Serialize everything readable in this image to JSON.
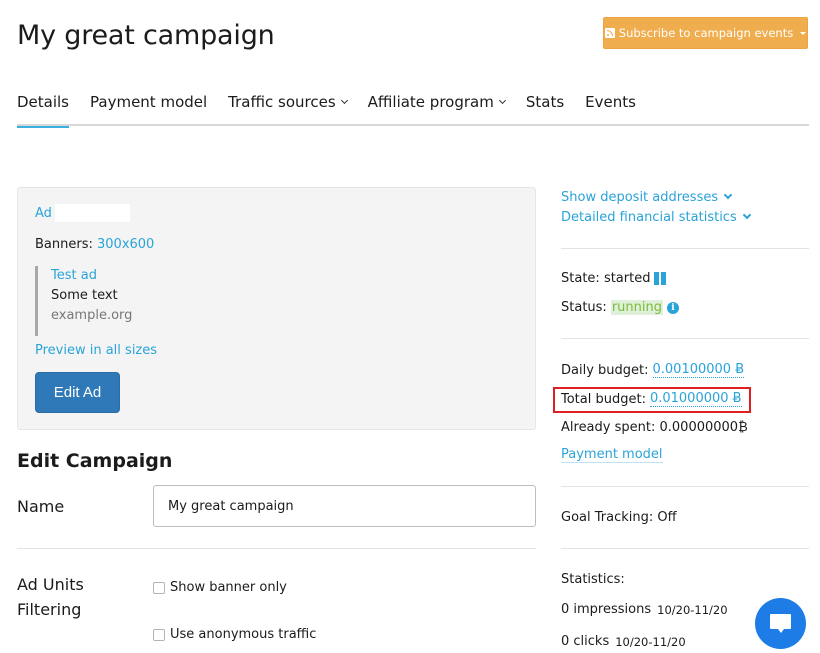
{
  "header": {
    "title": "My great campaign",
    "subscribe_label": "Subscribe to campaign events",
    "subscribe_color": "#f0ad4e"
  },
  "tabs": [
    {
      "label": "Details",
      "active": true,
      "has_dropdown": false
    },
    {
      "label": "Payment model",
      "active": false,
      "has_dropdown": false
    },
    {
      "label": "Traffic sources",
      "active": false,
      "has_dropdown": true
    },
    {
      "label": "Affiliate program",
      "active": false,
      "has_dropdown": true
    },
    {
      "label": "Stats",
      "active": false,
      "has_dropdown": false
    },
    {
      "label": "Events",
      "active": false,
      "has_dropdown": false
    }
  ],
  "ad_card": {
    "ad_label": "Ad",
    "banners_label": "Banners:",
    "banners_value": "300x600",
    "preview": {
      "title": "Test ad",
      "text": "Some text",
      "url": "example.org"
    },
    "preview_all_label": "Preview in all sizes",
    "edit_label": "Edit Ad"
  },
  "edit_campaign": {
    "title": "Edit Campaign",
    "name_label": "Name",
    "name_value": "My great campaign",
    "filtering_label_1": "Ad Units",
    "filtering_label_2": "Filtering",
    "options": [
      {
        "label": "Show banner only",
        "checked": false
      },
      {
        "label": "Use anonymous traffic",
        "checked": false
      }
    ]
  },
  "sidebar": {
    "deposit_link": "Show deposit addresses",
    "financial_link": "Detailed financial statistics",
    "state_label": "State:",
    "state_value": "started",
    "status_label": "Status:",
    "status_value": "running",
    "daily_budget_label": "Daily budget:",
    "daily_budget_value": "0.00100000 Ƀ",
    "total_budget_label": "Total budget:",
    "total_budget_value": "0.01000000 Ƀ",
    "spent_label": "Already spent:",
    "spent_value": "0.00000000₿",
    "payment_model_link": "Payment model",
    "goal_tracking": "Goal Tracking: Off",
    "statistics_label": "Statistics:",
    "impressions": "0 impressions",
    "impressions_range": "10/20-11/20",
    "clicks": "0 clicks",
    "clicks_range": "10/20-11/20"
  },
  "colors": {
    "accent": "#2aa3d9",
    "primary_button": "#2f79b9",
    "highlight": "#e02020",
    "running_bg": "#dff0d8",
    "running_text": "#7dbb3c",
    "chat": "#1e7ce6"
  }
}
